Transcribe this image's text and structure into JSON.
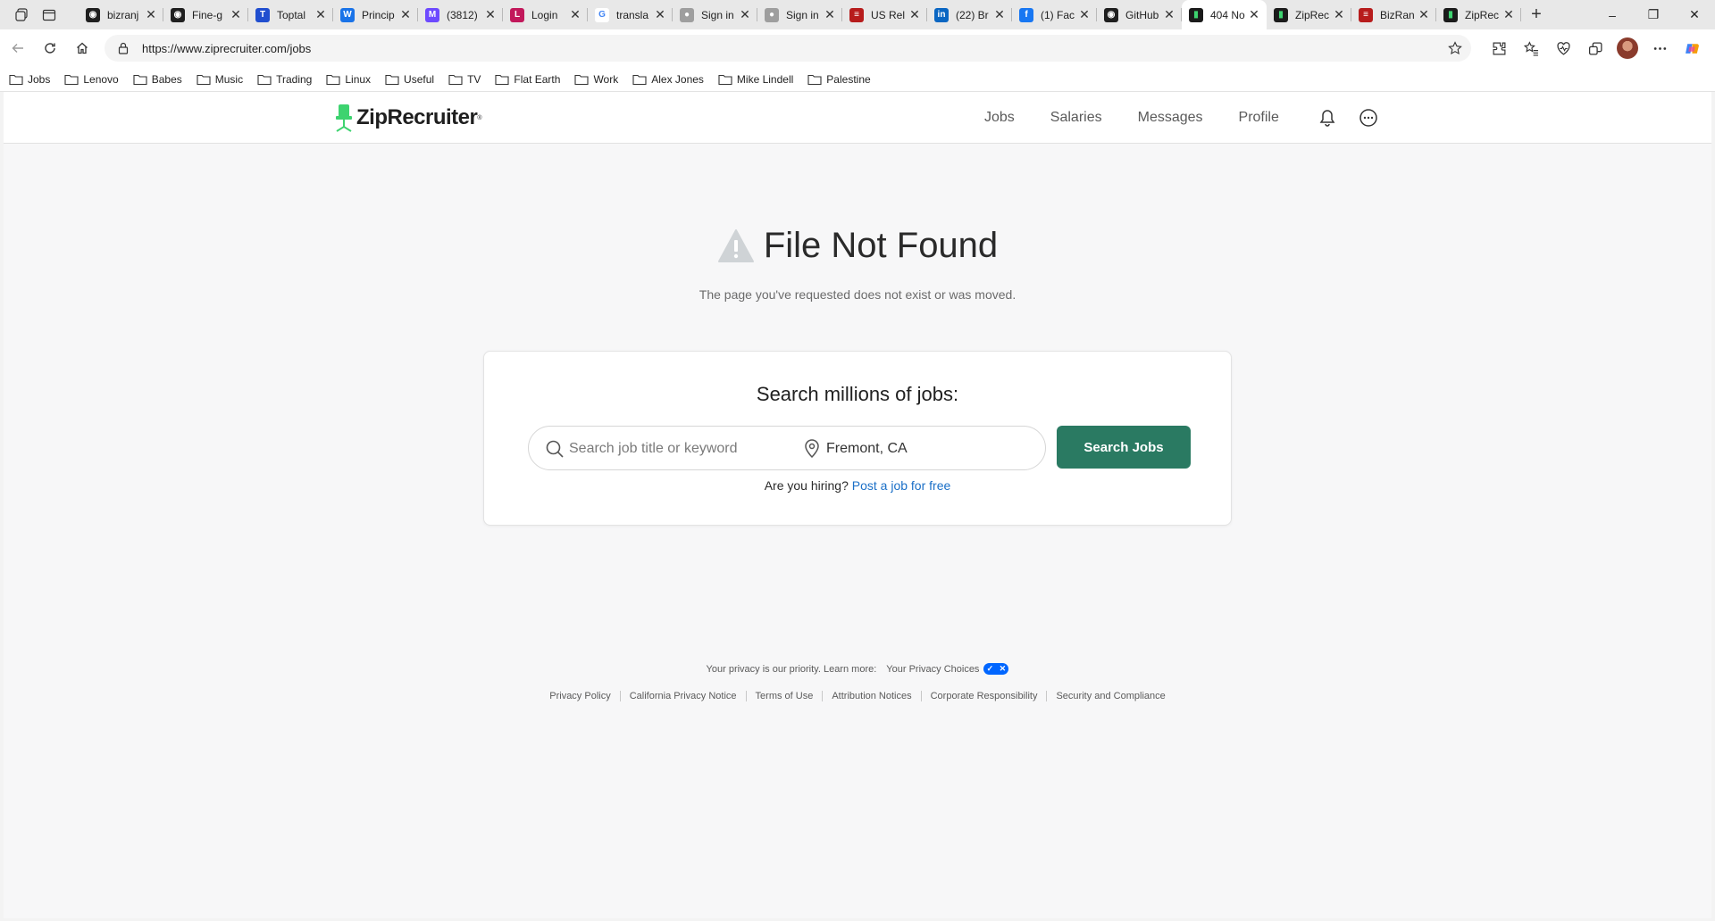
{
  "browser": {
    "tabs": [
      {
        "title": "bizranj",
        "favicon": "github-icon",
        "active": false
      },
      {
        "title": "Fine-g",
        "favicon": "github-icon",
        "active": false
      },
      {
        "title": "Toptal",
        "favicon": "toptal-icon",
        "active": false
      },
      {
        "title": "Princip",
        "favicon": "w-icon",
        "active": false
      },
      {
        "title": "(3812)",
        "favicon": "mail-icon",
        "active": false
      },
      {
        "title": "Login",
        "favicon": "page-icon",
        "active": false
      },
      {
        "title": "transla",
        "favicon": "google-icon",
        "active": false
      },
      {
        "title": "Sign in",
        "favicon": "person-icon",
        "active": false
      },
      {
        "title": "Sign in",
        "favicon": "person-icon",
        "active": false
      },
      {
        "title": "US Rel",
        "favicon": "flag-icon",
        "active": false
      },
      {
        "title": "(22) Br",
        "favicon": "linkedin-icon",
        "active": false
      },
      {
        "title": "(1) Fac",
        "favicon": "facebook-icon",
        "active": false
      },
      {
        "title": "GitHub",
        "favicon": "github-icon",
        "active": false
      },
      {
        "title": "404 No",
        "favicon": "ziprecruiter-icon",
        "active": true
      },
      {
        "title": "ZipRec",
        "favicon": "ziprecruiter-icon",
        "active": false
      },
      {
        "title": "BizRan",
        "favicon": "flag-icon",
        "active": false
      },
      {
        "title": "ZipRec",
        "favicon": "ziprecruiter-icon",
        "active": false
      }
    ],
    "url": "https://www.ziprecruiter.com/jobs",
    "bookmarks": [
      "Jobs",
      "Lenovo",
      "Babes",
      "Music",
      "Trading",
      "Linux",
      "Useful",
      "TV",
      "Flat Earth",
      "Work",
      "Alex Jones",
      "Mike Lindell",
      "Palestine"
    ]
  },
  "site": {
    "logo_text": "ZipRecruiter",
    "nav": [
      "Jobs",
      "Salaries",
      "Messages",
      "Profile"
    ]
  },
  "error": {
    "title": "File Not Found",
    "subtitle": "The page you've requested does not exist or was moved."
  },
  "search": {
    "heading": "Search millions of jobs:",
    "keyword_placeholder": "Search job title or keyword",
    "location_value": "Fremont, CA",
    "button_label": "Search Jobs",
    "hiring_prompt": "Are you hiring?",
    "hiring_link": "Post a job for free"
  },
  "footer": {
    "privacy_text": "Your privacy is our priority. Learn more:",
    "privacy_choices": "Your Privacy Choices",
    "links": [
      "Privacy Policy",
      "California Privacy Notice",
      "Terms of Use",
      "Attribution Notices",
      "Corporate Responsibility",
      "Security and Compliance"
    ]
  },
  "colors": {
    "brand_green": "#2a7a62",
    "logo_green": "#3dd36f",
    "link_blue": "#1a6fc7"
  }
}
